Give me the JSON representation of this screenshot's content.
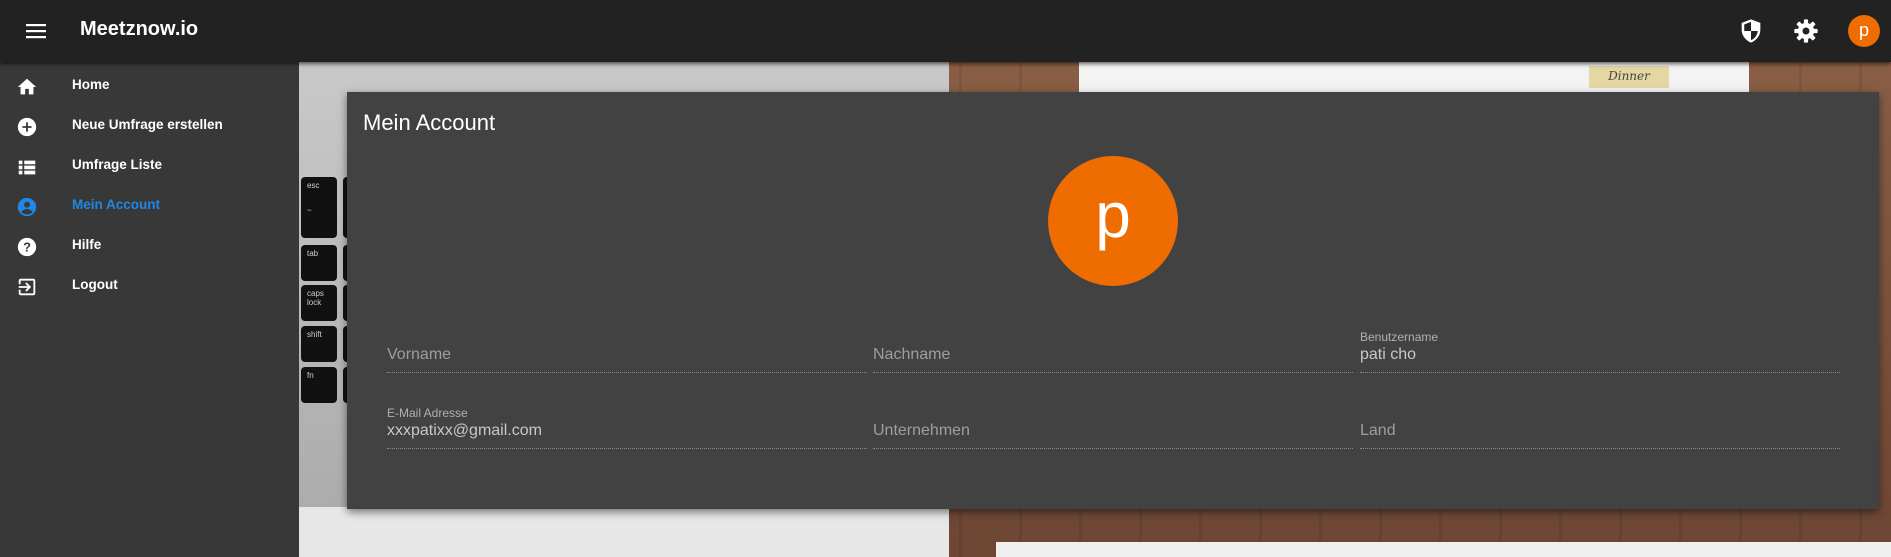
{
  "app": {
    "title": "Meetznow.io"
  },
  "topbar": {
    "avatar_initial": "p"
  },
  "sidebar": {
    "items": [
      {
        "label": "Home",
        "icon": "home-icon"
      },
      {
        "label": "Neue Umfrage erstellen",
        "icon": "add-circle-icon"
      },
      {
        "label": "Umfrage Liste",
        "icon": "list-icon"
      },
      {
        "label": "Mein Account",
        "icon": "account-circle-icon",
        "active": true
      },
      {
        "label": "Hilfe",
        "icon": "help-icon"
      },
      {
        "label": "Logout",
        "icon": "logout-icon"
      }
    ]
  },
  "background": {
    "keys": [
      "esc",
      "~",
      "tab",
      "caps lock",
      "shift",
      "fn"
    ],
    "note": "Dinner"
  },
  "account": {
    "title": "Mein Account",
    "avatar_initial": "p",
    "fields": {
      "vorname": {
        "label": "",
        "placeholder": "Vorname",
        "value": ""
      },
      "nachname": {
        "label": "",
        "placeholder": "Nachname",
        "value": ""
      },
      "benutzername": {
        "label": "Benutzername",
        "placeholder": "",
        "value": "pati cho"
      },
      "email": {
        "label": "E-Mail Adresse",
        "placeholder": "",
        "value": "xxxpatixx@gmail.com"
      },
      "unternehmen": {
        "label": "",
        "placeholder": "Unternehmen",
        "value": ""
      },
      "land": {
        "label": "",
        "placeholder": "Land",
        "value": ""
      }
    }
  },
  "colors": {
    "accent": "#ef6c00",
    "active_nav": "#1e88e5",
    "appbar": "#222222",
    "card": "#424242"
  }
}
